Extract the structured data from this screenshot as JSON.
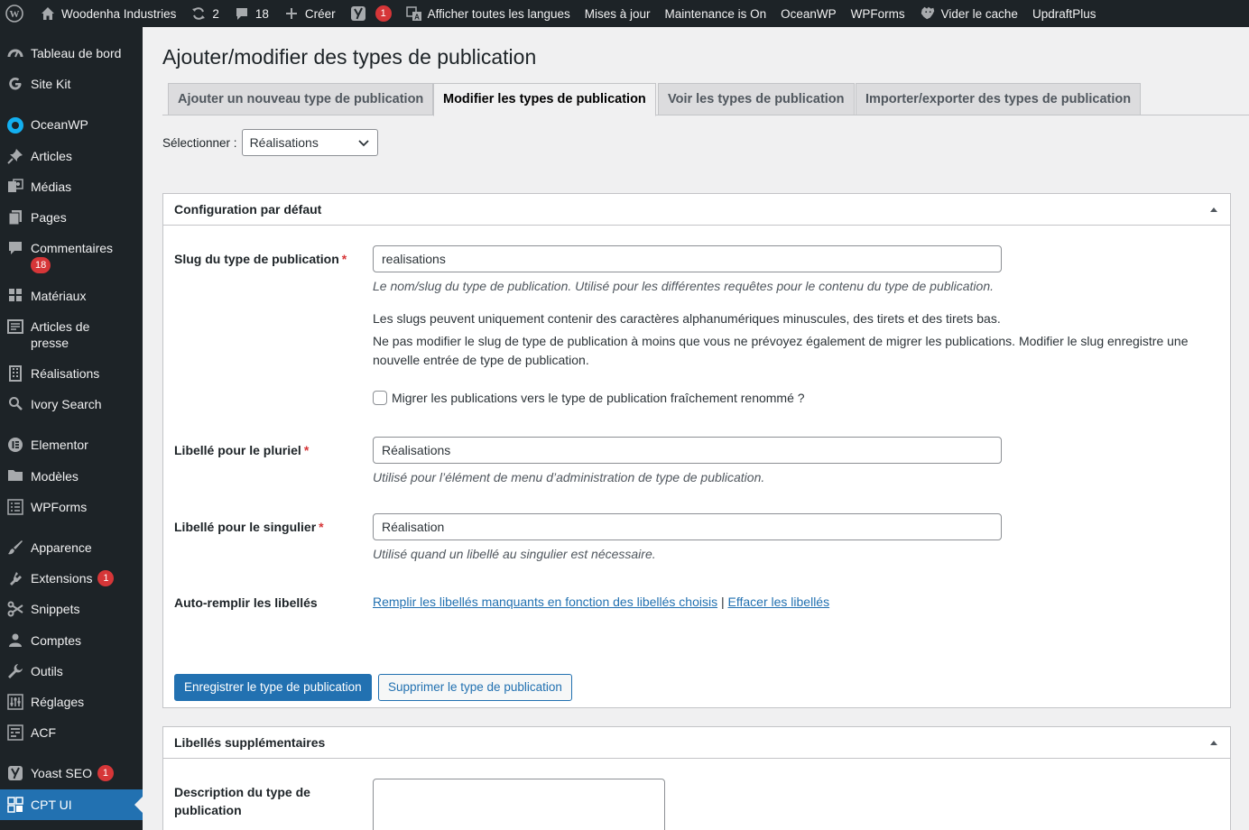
{
  "adminbar": {
    "site_name": "Woodenha Industries",
    "updates_count": "2",
    "comments_count": "18",
    "new_label": "Créer",
    "yoast_badge": "1",
    "languages_label": "Afficher toutes les langues",
    "updates_label": "Mises à jour",
    "maintenance_label": "Maintenance is On",
    "oceanwp_label": "OceanWP",
    "wpforms_label": "WPForms",
    "cache_label": "Vider le cache",
    "updraft_label": "UpdraftPlus"
  },
  "sidebar": {
    "items": [
      {
        "label": "Tableau de bord",
        "icon": "dashboard-icon"
      },
      {
        "label": "Site Kit",
        "icon": "google-icon"
      },
      {
        "label": "OceanWP",
        "icon": "oceanwp-icon"
      },
      {
        "label": "Articles",
        "icon": "pin-icon"
      },
      {
        "label": "Médias",
        "icon": "media-icon"
      },
      {
        "label": "Pages",
        "icon": "pages-icon"
      },
      {
        "label": "Commentaires",
        "icon": "comments-icon",
        "badge": "18"
      },
      {
        "label": "Matériaux",
        "icon": "grid-icon"
      },
      {
        "label": "Articles de presse",
        "icon": "press-icon"
      },
      {
        "label": "Réalisations",
        "icon": "building-icon"
      },
      {
        "label": "Ivory Search",
        "icon": "search-icon"
      },
      {
        "label": "Elementor",
        "icon": "elementor-icon"
      },
      {
        "label": "Modèles",
        "icon": "folder-icon"
      },
      {
        "label": "WPForms",
        "icon": "forms-icon"
      },
      {
        "label": "Apparence",
        "icon": "brush-icon"
      },
      {
        "label": "Extensions",
        "icon": "plugin-icon",
        "badge": "1"
      },
      {
        "label": "Snippets",
        "icon": "scissors-icon"
      },
      {
        "label": "Comptes",
        "icon": "user-icon"
      },
      {
        "label": "Outils",
        "icon": "wrench-icon"
      },
      {
        "label": "Réglages",
        "icon": "settings-icon"
      },
      {
        "label": "ACF",
        "icon": "acf-icon"
      },
      {
        "label": "Yoast SEO",
        "icon": "yoast-icon",
        "badge": "1"
      },
      {
        "label": "CPT UI",
        "icon": "cptui-icon"
      }
    ]
  },
  "page": {
    "title": "Ajouter/modifier des types de publication",
    "tabs": [
      {
        "label": "Ajouter un nouveau type de publication"
      },
      {
        "label": "Modifier les types de publication"
      },
      {
        "label": "Voir les types de publication"
      },
      {
        "label": "Importer/exporter des types de publication"
      }
    ],
    "select_label": "Sélectionner :",
    "select_value": "Réalisations"
  },
  "config": {
    "heading": "Configuration par défaut",
    "slug_label": "Slug du type de publication",
    "slug_value": "realisations",
    "slug_help": "Le nom/slug du type de publication. Utilisé pour les différentes requêtes pour le contenu du type de publication.",
    "slug_info1": "Les slugs peuvent uniquement contenir des caractères alphanumériques minuscules, des tirets et des tirets bas.",
    "slug_info2": "Ne pas modifier le slug de type de publication à moins que vous ne prévoyez également de migrer les publications. Modifier le slug enregistre une nouvelle entrée de type de publication.",
    "migrate_label": "Migrer les publications vers le type de publication fraîchement renommé ?",
    "plural_label": "Libellé pour le pluriel",
    "plural_value": "Réalisations",
    "plural_help": "Utilisé pour l’élément de menu d’administration de type de publication.",
    "singular_label": "Libellé pour le singulier",
    "singular_value": "Réalisation",
    "singular_help": "Utilisé quand un libellé au singulier est nécessaire.",
    "autofill_label": "Auto-remplir les libellés",
    "autofill_link": "Remplir les libellés manquants en fonction des libellés choisis",
    "separator": "|",
    "clear_link": "Effacer les libellés",
    "required_mark": "*",
    "save_button": "Enregistrer le type de publication",
    "delete_button": "Supprimer le type de publication"
  },
  "extra": {
    "heading": "Libellés supplémentaires",
    "description_label": "Description du type de publication"
  },
  "colors": {
    "accent": "#2271b1",
    "admin_dark": "#1d2327",
    "badge": "#d63638"
  }
}
